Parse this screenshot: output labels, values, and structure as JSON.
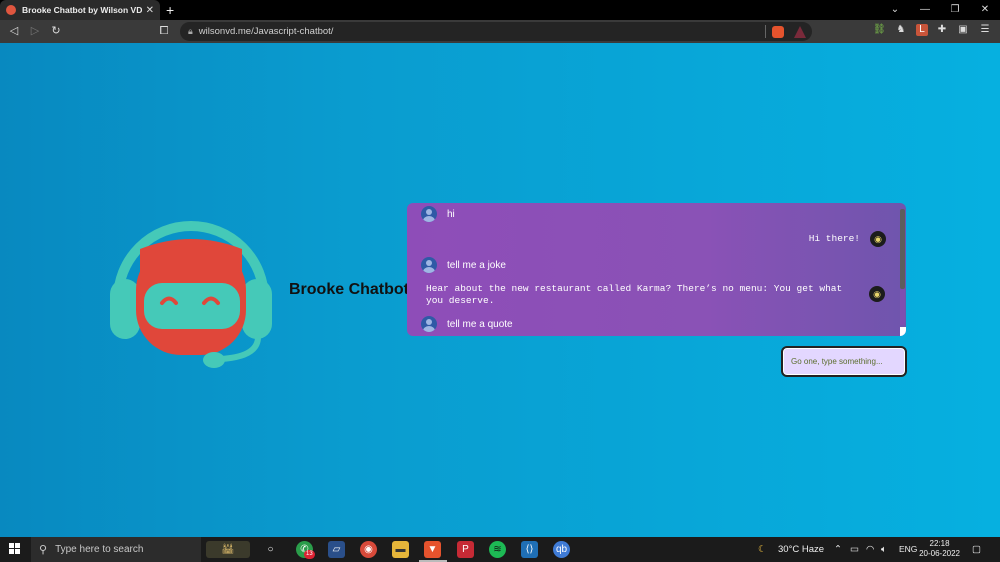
{
  "browser": {
    "tab_title": "Brooke Chatbot by Wilson VD",
    "tab_close": "✕",
    "new_tab": "+",
    "url": "wilsonvd.me/Javascript-chatbot/",
    "window_controls": [
      "⌄",
      "—",
      "❐",
      "✕"
    ],
    "nav": {
      "back": "◁",
      "forward": "▷",
      "reload": "↻",
      "bookmark": "⧠"
    }
  },
  "page": {
    "brand_title": "Brooke Chatbot",
    "messages": [
      {
        "sender": "user",
        "text": "hi"
      },
      {
        "sender": "bot",
        "text": "Hi there!"
      },
      {
        "sender": "user",
        "text": "tell me a joke"
      },
      {
        "sender": "bot",
        "text": "Hear about the new restaurant called Karma? There’s no menu: You get what you deserve."
      },
      {
        "sender": "user",
        "text": "tell me a quote"
      }
    ],
    "input_placeholder": "Go one, type something...",
    "colors": {
      "background": "#0a9ccf",
      "chat_panel": "#8a52b6",
      "robot_teal": "#45c9b8",
      "robot_red": "#e0473a"
    }
  },
  "taskbar": {
    "search_placeholder": "Type here to search",
    "weather": "30°C Haze",
    "language": "ENG",
    "time": "22:18",
    "date": "20-06-2022",
    "whatsapp_badge": "13"
  }
}
